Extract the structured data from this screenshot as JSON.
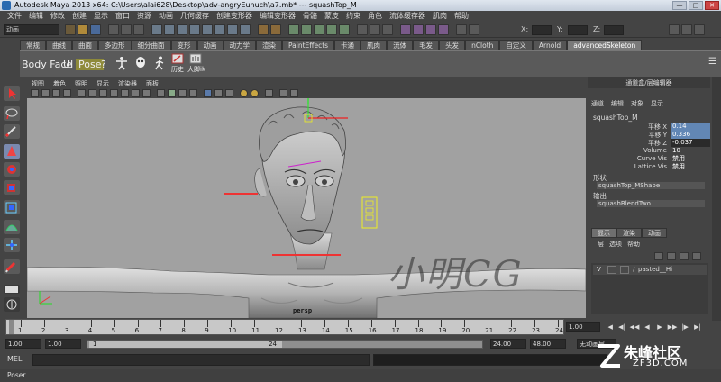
{
  "window": {
    "title": "Autodesk Maya 2013 x64: C:\\Users\\alai628\\Desktop\\adv-angryEunuch\\a7.mb*   ---   squashTop_M",
    "controls": [
      "—",
      "□",
      "✕"
    ]
  },
  "menubar": [
    "文件",
    "编辑",
    "修改",
    "创建",
    "显示",
    "窗口",
    "资源",
    "动画",
    "几何缓存",
    "创建变形器",
    "编辑变形器",
    "骨骼",
    "蒙皮",
    "约束",
    "角色",
    "流体缓存器",
    "肌肉",
    "帮助"
  ],
  "statusline": {
    "mode": "动画",
    "x_label": "X:",
    "y_label": "Y:",
    "z_label": "Z:"
  },
  "shelf_tabs": [
    "常规",
    "曲线",
    "曲面",
    "多边形",
    "细分曲面",
    "变形",
    "动画",
    "动力学",
    "渲染",
    "PaintEffects",
    "卡通",
    "肌肉",
    "流体",
    "毛发",
    "头发",
    "nCloth",
    "自定义",
    "Arnold",
    "advancedSkeleton"
  ],
  "shelf_active_tab": "advancedSkeleton",
  "shelf_buttons": {
    "body_face": "Body Face",
    "ui": "UI",
    "pose": "Pose",
    "help": "?",
    "history": "历史",
    "big_hand": "大脚ik"
  },
  "viewport": {
    "menu": [
      "视图",
      "着色",
      "照明",
      "显示",
      "渲染器",
      "面板"
    ],
    "camera_label": "persp"
  },
  "channel_box": {
    "header": "通道盒/层编辑器",
    "menu": [
      "通道",
      "编辑",
      "对象",
      "显示"
    ],
    "node": "squashTop_M",
    "attributes": [
      {
        "name": "平移 X",
        "value": "0.14"
      },
      {
        "name": "平移 Y",
        "value": "0.336"
      },
      {
        "name": "平移 Z",
        "value": "-0.037"
      },
      {
        "name": "Volume",
        "value": "10"
      },
      {
        "name": "Curve Vis",
        "value": "禁用"
      },
      {
        "name": "Lattice Vis",
        "value": "禁用"
      }
    ],
    "shapes_label": "形状",
    "shape_node": "squashTop_MShape",
    "outputs_label": "输出",
    "output_node": "squashBlendTwo"
  },
  "layer_editor": {
    "tabs": [
      "显示",
      "渲染",
      "动画"
    ],
    "menu": [
      "层",
      "选项",
      "帮助"
    ],
    "layer": {
      "visible": "V",
      "name": "pasted__Hi"
    }
  },
  "time_slider": {
    "ticks": [
      1,
      2,
      3,
      4,
      5,
      6,
      7,
      8,
      9,
      10,
      11,
      12,
      13,
      14,
      15,
      16,
      17,
      18,
      19,
      20,
      21,
      22,
      23,
      24
    ],
    "current_frame": "1.00"
  },
  "range_slider": {
    "start": "1.00",
    "inner_start": "1.00",
    "range_start_marker": "1",
    "range_end_marker": "24",
    "end": "24.00",
    "outer_end": "48.00",
    "anim_layer": "无动画层"
  },
  "command_line": {
    "label": "MEL"
  },
  "help_line": "Poser",
  "watermarks": {
    "cg": "小明CG",
    "site": "朱峰社区",
    "url": "ZF3D.COM"
  },
  "colors": {
    "viewport_bg": "#a1a1a1",
    "selection_highlight": "#6287b5",
    "pose_button": "#8e8a3a"
  }
}
